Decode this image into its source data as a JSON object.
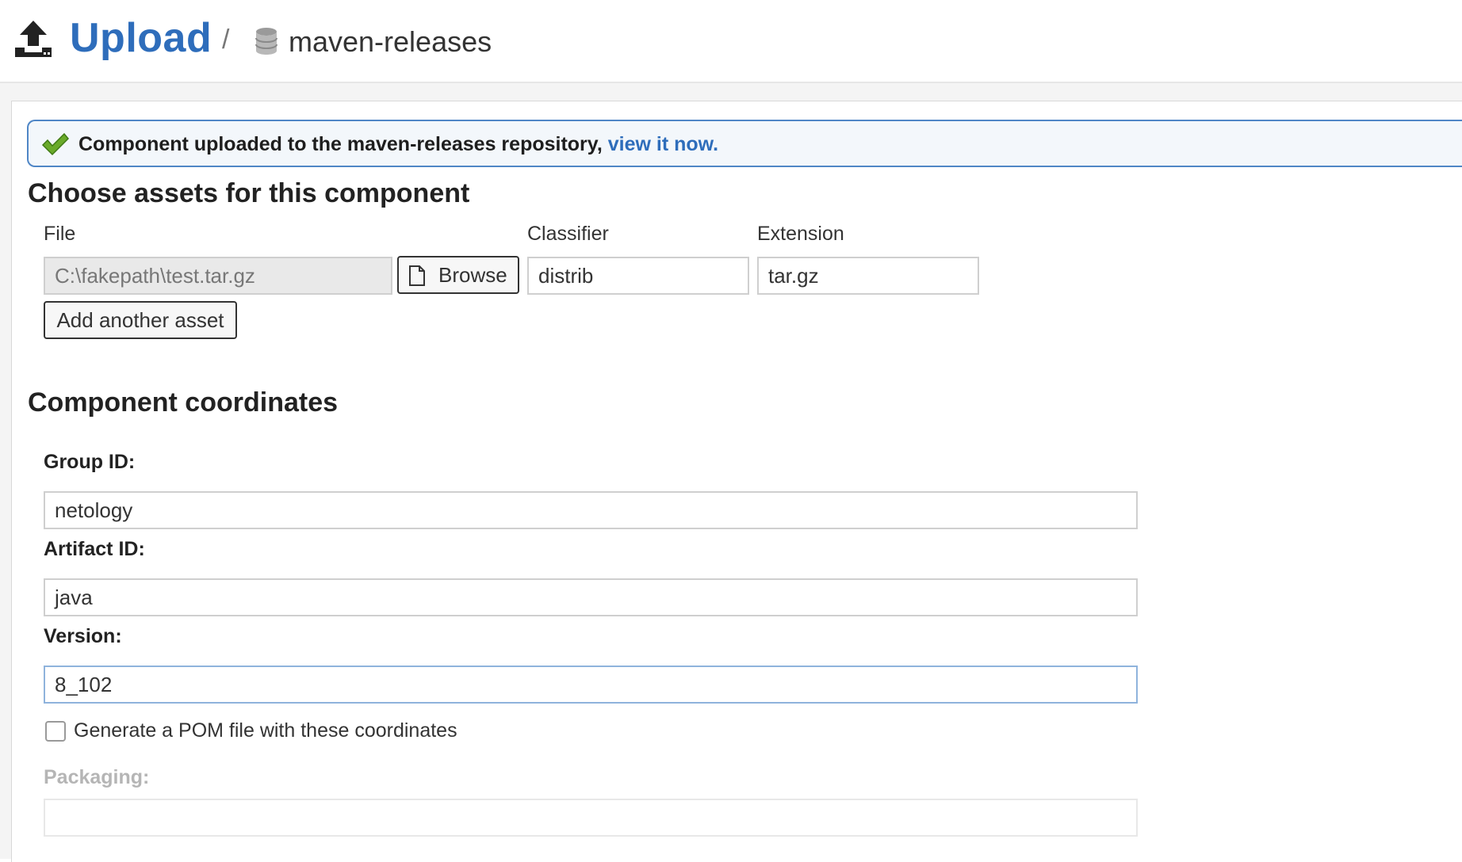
{
  "header": {
    "title": "Upload",
    "separator": "/",
    "repository": "maven-releases",
    "icons": {
      "upload": "upload-icon",
      "repository": "database-icon"
    }
  },
  "alert": {
    "message": "Component uploaded to the maven-releases repository,",
    "link_text": "view it now.",
    "icon": "check-icon",
    "accent_color": "#4f86c6"
  },
  "assets": {
    "heading": "Choose assets for this component",
    "columns": {
      "file": "File",
      "classifier": "Classifier",
      "extension": "Extension"
    },
    "file_value": "C:\\fakepath\\test.tar.gz",
    "browse_label": "Browse",
    "classifier_value": "distrib",
    "extension_value": "tar.gz",
    "add_asset_label": "Add another asset"
  },
  "coordinates": {
    "heading": "Component coordinates",
    "group_id_label": "Group ID:",
    "group_id_value": "netology",
    "artifact_id_label": "Artifact ID:",
    "artifact_id_value": "java",
    "version_label": "Version:",
    "version_value": "8_102",
    "generate_pom_label": "Generate a POM file with these coordinates",
    "generate_pom_checked": false,
    "packaging_label": "Packaging:",
    "packaging_value": ""
  },
  "colors": {
    "brand_blue": "#2e6dbb",
    "success_green": "#6aaa2a"
  }
}
